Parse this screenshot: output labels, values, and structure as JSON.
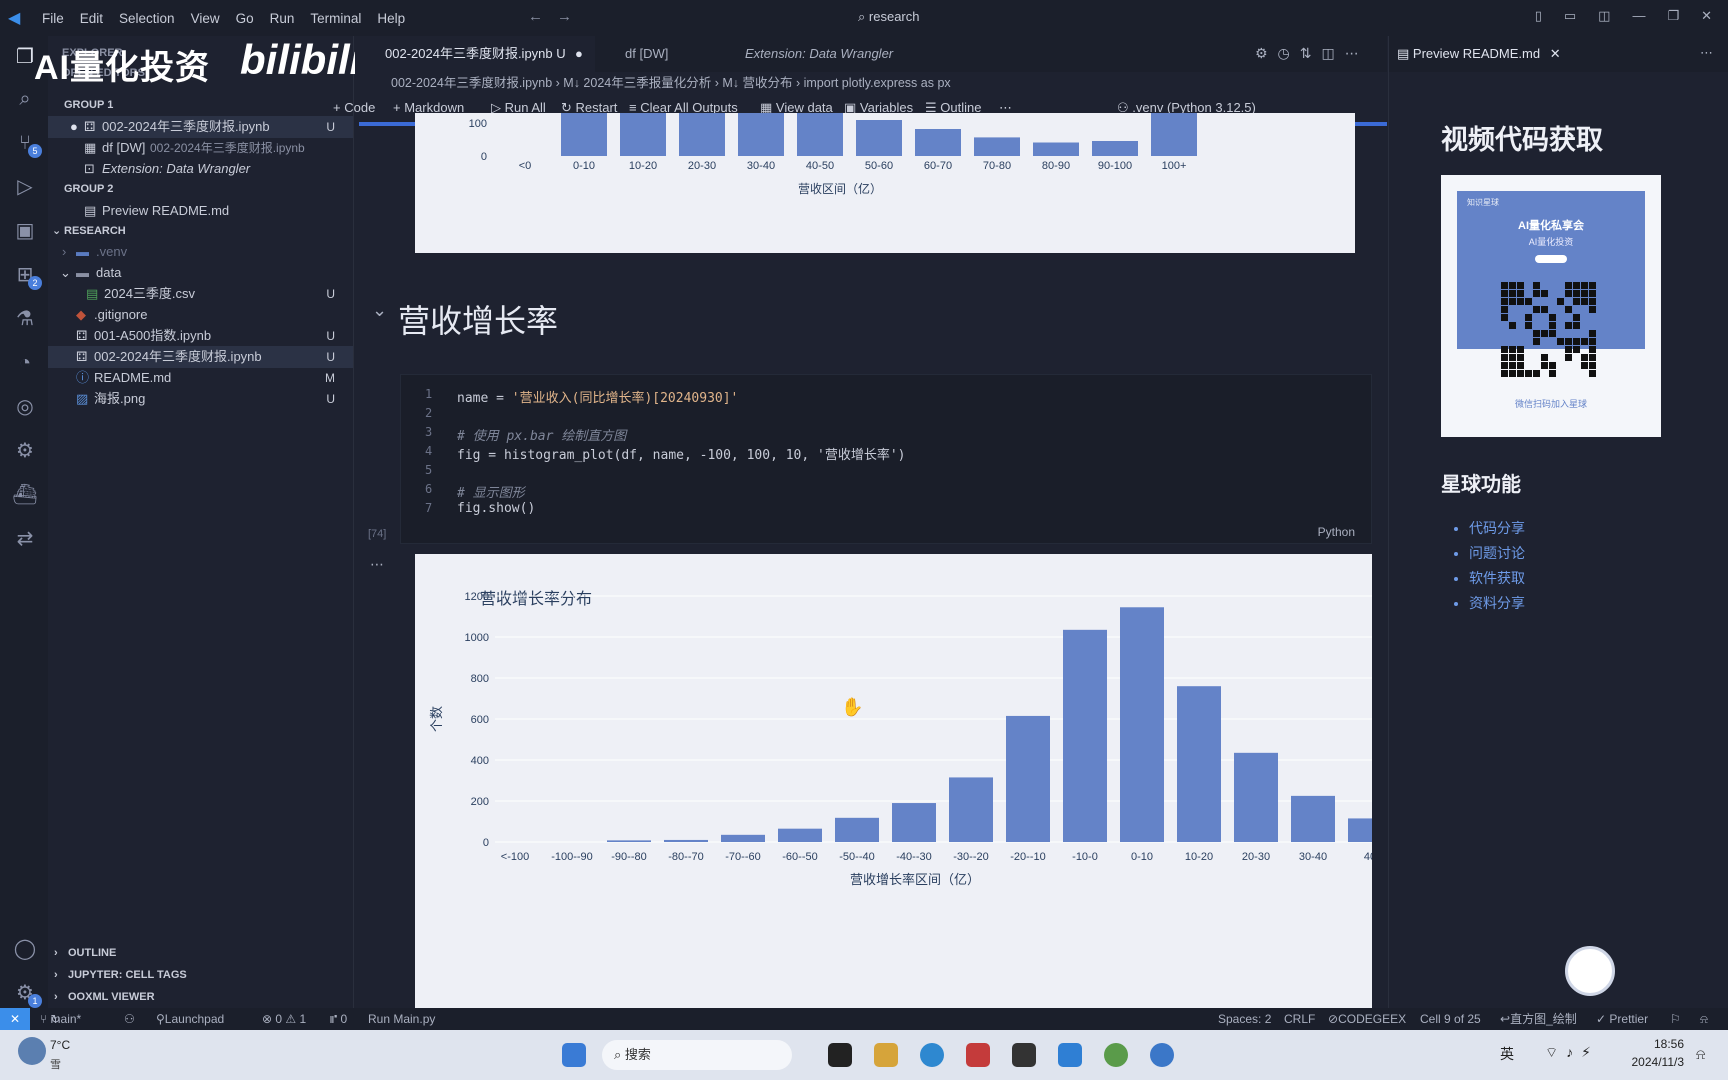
{
  "menu": [
    "File",
    "Edit",
    "Selection",
    "View",
    "Go",
    "Run",
    "Terminal",
    "Help"
  ],
  "search": "research",
  "watermark": {
    "left": "AI量化投资",
    "right": "bilibili"
  },
  "explorer": {
    "title": "EXPLORER",
    "open_editors_label": "OPEN EDITORS",
    "group1": "GROUP 1",
    "group1_items": [
      {
        "name": "002-2024年三季度财报.ipynb",
        "status": "U"
      },
      {
        "name": "df [DW]",
        "detail": "002-2024年三季度财报.ipynb"
      },
      {
        "name": "Extension: Data Wrangler"
      }
    ],
    "group2": "GROUP 2",
    "group2_items": [
      {
        "name": "Preview README.md"
      }
    ],
    "research": "RESEARCH",
    "tree": [
      {
        "name": ".venv",
        "status": ""
      },
      {
        "name": "data",
        "status": ""
      },
      {
        "name": "2024三季度.csv",
        "status": "U"
      },
      {
        "name": ".gitignore",
        "status": ""
      },
      {
        "name": "001-A500指数.ipynb",
        "status": "U"
      },
      {
        "name": "002-2024年三季度财报.ipynb",
        "status": "U"
      },
      {
        "name": "README.md",
        "status": "M"
      },
      {
        "name": "海报.png",
        "status": "U"
      }
    ],
    "outline": "OUTLINE",
    "cell_tags": "JUPYTER: CELL TAGS",
    "ooxml": "OOXML VIEWER"
  },
  "tabs": [
    {
      "label": "002-2024年三季度财报.ipynb",
      "status": "U"
    },
    {
      "label": "df [DW]"
    },
    {
      "label": "Extension: Data Wrangler"
    }
  ],
  "preview_tab": "Preview README.md",
  "breadcrumb": [
    "002-2024年三季度财报.ipynb",
    "M↓ 2024年三季报量化分析",
    "M↓ 营收分布",
    "import plotly.express as px"
  ],
  "nb_toolbar": {
    "code": "Code",
    "markdown": "Markdown",
    "run_all": "Run All",
    "restart": "Restart",
    "clear": "Clear All Outputs",
    "view_data": "View data",
    "variables": "Variables",
    "outline": "Outline",
    "kernel": ".venv (Python 3.12.5)"
  },
  "top_chart": {
    "xlabel": "营收区间（亿）",
    "y_ticks": [
      "100",
      "0"
    ],
    "categories": [
      "<0",
      "0-10",
      "10-20",
      "20-30",
      "30-40",
      "40-50",
      "50-60",
      "60-70",
      "70-80",
      "80-90",
      "90-100",
      "100+"
    ],
    "values": [
      0,
      170,
      170,
      170,
      170,
      170,
      120,
      90,
      62,
      45,
      50,
      170
    ]
  },
  "section_heading": "营收增长率",
  "code": {
    "lines": [
      {
        "n": "1",
        "text": "name = '营业收入(同比增长率)[20240930]'"
      },
      {
        "n": "2",
        "text": ""
      },
      {
        "n": "3",
        "text": "# 使用 px.bar 绘制直方图"
      },
      {
        "n": "4",
        "text": "fig = histogram_plot(df, name, -100, 100, 10, '营收增长率')"
      },
      {
        "n": "5",
        "text": ""
      },
      {
        "n": "6",
        "text": "# 显示图形"
      },
      {
        "n": "7",
        "text": "fig.show()"
      }
    ],
    "exec_count": "[74]",
    "language": "Python"
  },
  "chart_data": {
    "type": "bar",
    "title": "营收增长率分布",
    "xlabel": "营收增长率区间（亿）",
    "ylabel": "个数",
    "ylim": [
      0,
      1250
    ],
    "y_ticks": [
      0,
      200,
      400,
      600,
      800,
      1000,
      1200
    ],
    "categories": [
      "<-100",
      "-100--90",
      "-90--80",
      "-80--70",
      "-70--60",
      "-60--50",
      "-50--40",
      "-40--30",
      "-30--20",
      "-20--10",
      "-10-0",
      "0-10",
      "10-20",
      "20-30",
      "30-40",
      "40"
    ],
    "values": [
      0,
      0,
      8,
      10,
      35,
      65,
      118,
      190,
      315,
      615,
      1035,
      1145,
      760,
      435,
      225,
      115
    ],
    "color": "#6483c8"
  },
  "preview": {
    "h1": "视频代码获取",
    "card_brand": "知识星球",
    "card_title": "AI量化私享会",
    "card_sub": "AI量化投资",
    "card_caption": "微信扫码加入星球",
    "h2": "星球功能",
    "list": [
      "代码分享",
      "问题讨论",
      "软件获取",
      "资料分享"
    ]
  },
  "status": {
    "branch": "main*",
    "launchpad": "Launchpad",
    "problems": "⊗ 0 ⚠ 1",
    "ports": "⑈ 0",
    "run_main": "Run Main.py",
    "spaces": "Spaces: 2",
    "eol": "CRLF",
    "codegeex": "CODEGEEX",
    "cell": "Cell 9 of 25",
    "dir": "直方图_绘制",
    "prettier": "✓ Prettier"
  },
  "taskbar": {
    "weather": "7°C",
    "weather_sub": "雪",
    "search": "搜索",
    "ime": "英",
    "time": "18:56",
    "date": "2024/11/3"
  },
  "colors": {
    "bar": "#6483c8",
    "accent": "#3b8eea",
    "editor_bg": "#1e2230"
  }
}
